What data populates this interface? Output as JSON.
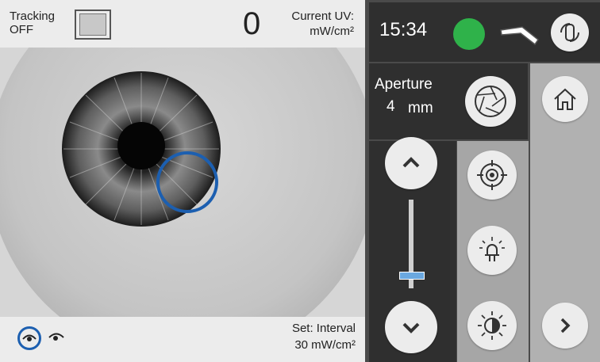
{
  "tracking": {
    "label": "Tracking",
    "state": "OFF"
  },
  "counter": "0",
  "current_uv": {
    "label": "Current UV:",
    "unit": "mW/cm²"
  },
  "set": {
    "label": "Set: Interval",
    "value": "30 mW/cm²"
  },
  "status": {
    "time": "15:34",
    "indicator_color": "#2fb24a"
  },
  "aperture": {
    "label": "Aperture",
    "value": "4",
    "unit": "mm"
  },
  "slider": {
    "level": 0.15
  },
  "colors": {
    "accent_blue": "#1c5fb0",
    "slider_blue": "#6aa8e0"
  }
}
